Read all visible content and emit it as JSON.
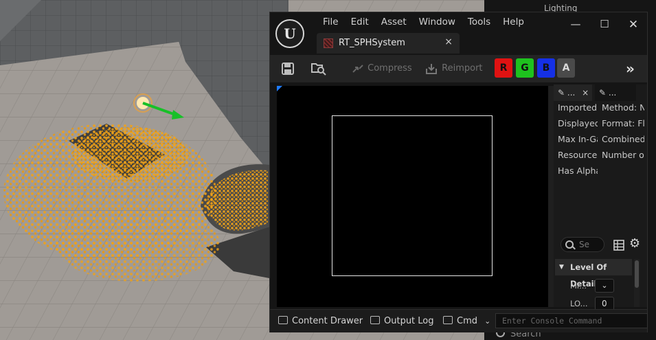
{
  "background": {
    "outliner_item": "Lighting",
    "search_placeholder": "Search"
  },
  "window": {
    "menu": [
      "File",
      "Edit",
      "Asset",
      "Window",
      "Tools",
      "Help"
    ],
    "tab_title": "RT_SPHSystem",
    "tab_close": "×",
    "controls": {
      "minimize": "—",
      "maximize": "☐",
      "close": "✕"
    }
  },
  "toolbar": {
    "compress": "Compress",
    "reimport": "Reimport",
    "channels": [
      {
        "label": "R",
        "color": "#e01212"
      },
      {
        "label": "G",
        "color": "#1ec21e"
      },
      {
        "label": "B",
        "color": "#1530e6"
      },
      {
        "label": "A",
        "color": "#4a4a4a"
      }
    ],
    "more": "»"
  },
  "details": {
    "tabs": [
      {
        "label": "...",
        "close": "×"
      },
      {
        "label": "..."
      }
    ],
    "rows": [
      [
        "Imported:",
        "Method: N"
      ],
      [
        "Displayed",
        "Format: Fl"
      ],
      [
        "Max In-Ga",
        "Combined"
      ],
      [
        "Resource",
        "Number o"
      ],
      [
        "Has Alpha",
        ""
      ]
    ],
    "search_placeholder": "Se",
    "lod": {
      "header": "Level Of Detail",
      "rows": [
        {
          "label": "Mi...",
          "value": "⌄"
        },
        {
          "label": "LO...",
          "value": "0"
        }
      ]
    }
  },
  "statusbar": {
    "content_drawer": "Content Drawer",
    "output_log": "Output Log",
    "cmd": "Cmd",
    "console_placeholder": "Enter Console Command"
  }
}
